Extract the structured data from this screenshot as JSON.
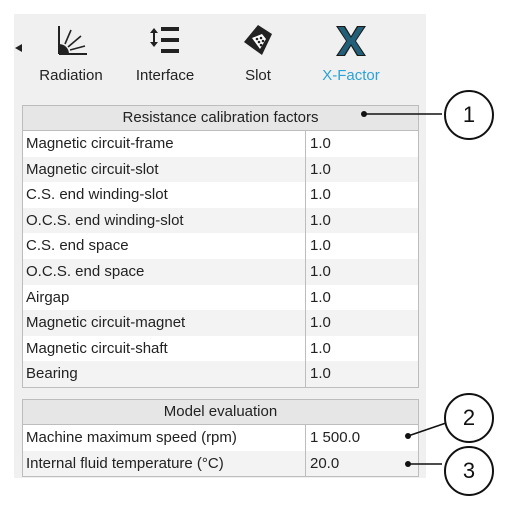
{
  "toolbar": {
    "items": [
      {
        "label": "Radiation",
        "icon": "radiation-icon",
        "active": false
      },
      {
        "label": "Interface",
        "icon": "interface-icon",
        "active": false
      },
      {
        "label": "Slot",
        "icon": "slot-icon",
        "active": false
      },
      {
        "label": "X-Factor",
        "icon": "x-factor-icon",
        "active": true
      }
    ],
    "active_color": "#2aa3d6"
  },
  "resistance": {
    "title": "Resistance calibration factors",
    "rows": [
      {
        "name": "Magnetic circuit-frame",
        "value": "1.0"
      },
      {
        "name": "Magnetic circuit-slot",
        "value": "1.0"
      },
      {
        "name": "C.S. end winding-slot",
        "value": "1.0"
      },
      {
        "name": "O.C.S. end winding-slot",
        "value": "1.0"
      },
      {
        "name": "C.S. end space",
        "value": "1.0"
      },
      {
        "name": "O.C.S. end space",
        "value": "1.0"
      },
      {
        "name": "Airgap",
        "value": "1.0"
      },
      {
        "name": "Magnetic circuit-magnet",
        "value": "1.0"
      },
      {
        "name": "Magnetic circuit-shaft",
        "value": "1.0"
      },
      {
        "name": "Bearing",
        "value": "1.0"
      }
    ]
  },
  "model_evaluation": {
    "title": "Model evaluation",
    "rows": [
      {
        "name": "Machine maximum speed (rpm)",
        "value": "1 500.0"
      },
      {
        "name": "Internal fluid temperature (°C)",
        "value": "20.0"
      }
    ]
  },
  "callouts": [
    "1",
    "2",
    "3"
  ]
}
